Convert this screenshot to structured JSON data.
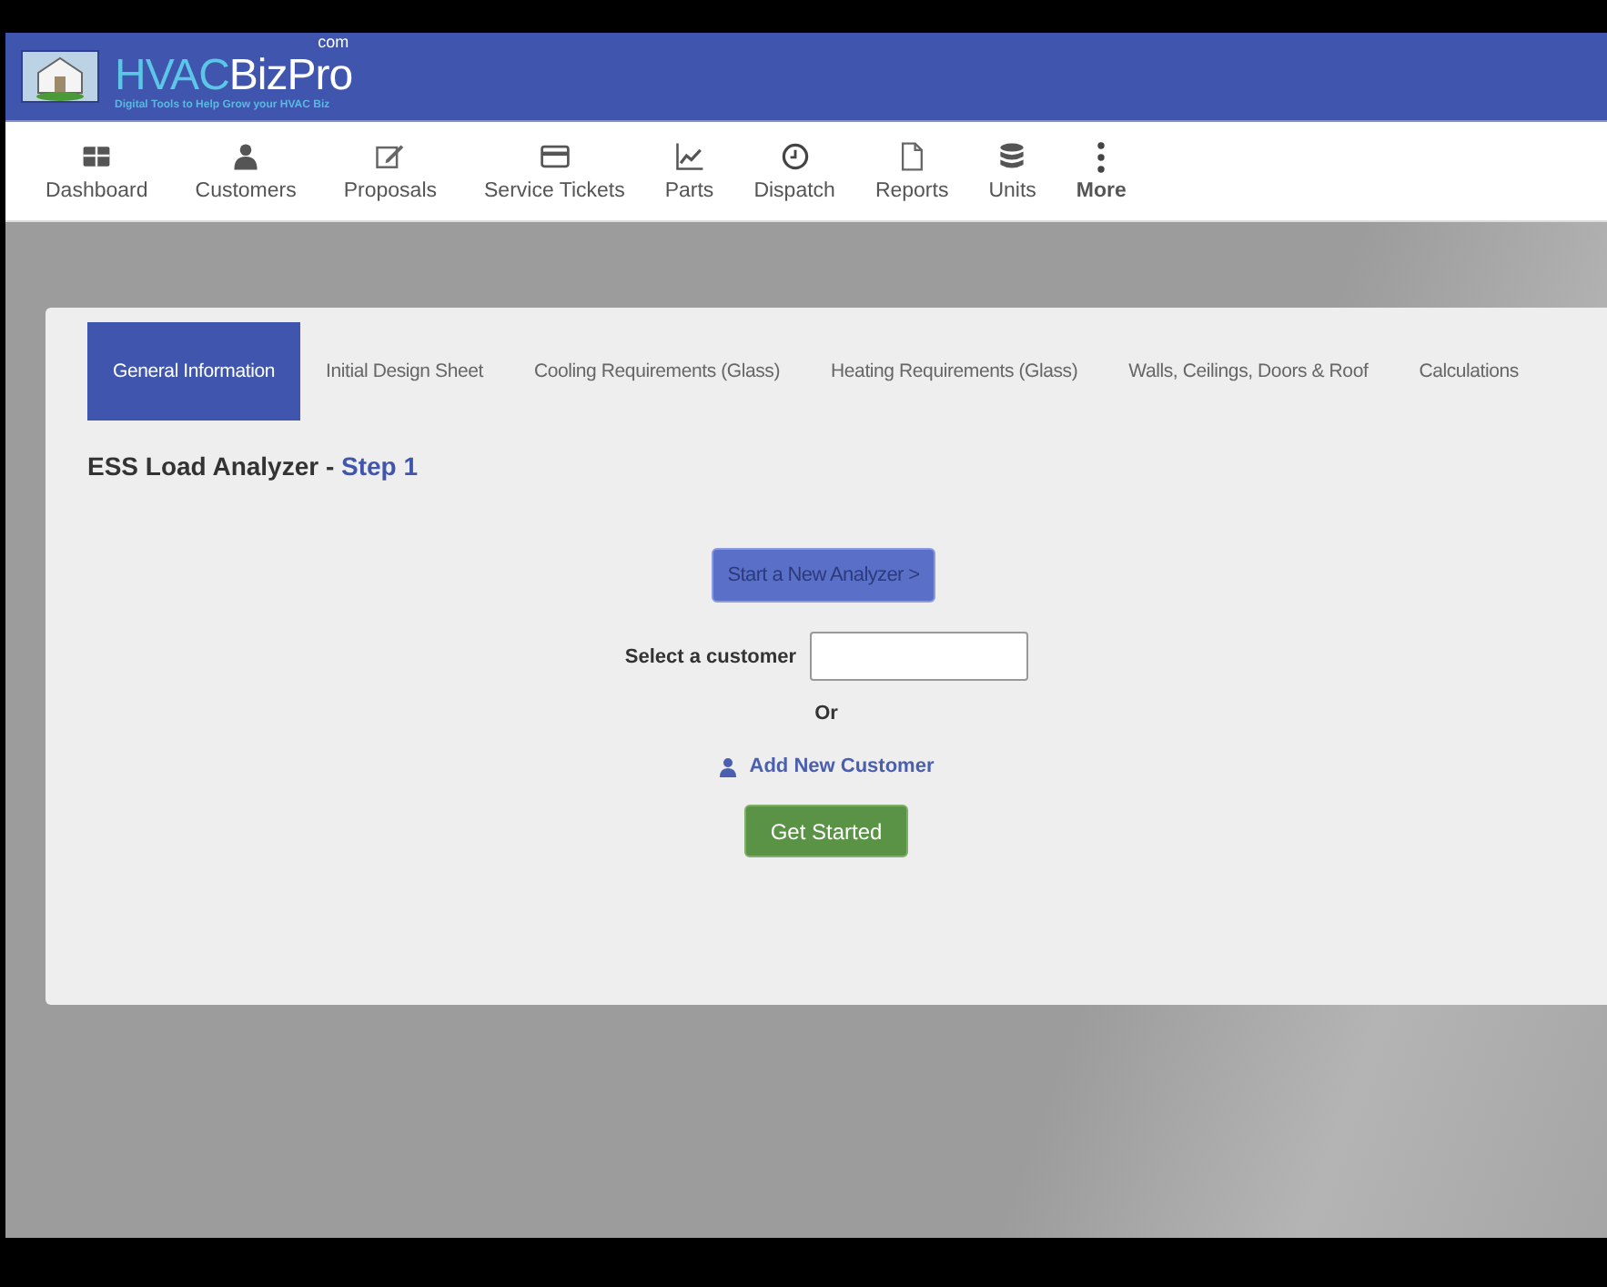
{
  "header": {
    "logo": {
      "part1": "HVAC",
      "part2": "BizPro",
      "suffix": "com",
      "tagline": "Digital Tools to Help Grow your HVAC Biz"
    }
  },
  "nav": [
    {
      "label": "Dashboard",
      "kind": "dashboard",
      "bold": false
    },
    {
      "label": "Customers",
      "kind": "person",
      "bold": false
    },
    {
      "label": "Proposals",
      "kind": "edit",
      "bold": false
    },
    {
      "label": "Service Tickets",
      "kind": "card",
      "bold": false
    },
    {
      "label": "Parts",
      "kind": "chart",
      "bold": false
    },
    {
      "label": "Dispatch",
      "kind": "clock",
      "bold": false
    },
    {
      "label": "Reports",
      "kind": "file",
      "bold": false
    },
    {
      "label": "Units",
      "kind": "database",
      "bold": false
    },
    {
      "label": "More",
      "kind": "dots",
      "bold": true
    }
  ],
  "tabs": [
    {
      "label": "General Information",
      "selected": true
    },
    {
      "label": "Initial Design Sheet",
      "selected": false
    },
    {
      "label": "Cooling Requirements (Glass)",
      "selected": false
    },
    {
      "label": "Heating Requirements (Glass)",
      "selected": false
    },
    {
      "label": "Walls, Ceilings, Doors & Roof",
      "selected": false
    },
    {
      "label": "Calculations",
      "selected": false
    }
  ],
  "heading": {
    "title": "ESS Load Analyzer - ",
    "step": "Step 1"
  },
  "form": {
    "start_button": "Start a New Analyzer >",
    "customer_label": "Select a customer",
    "or": "Or",
    "add_link": "Add New Customer",
    "submit_button": "Get Started"
  }
}
